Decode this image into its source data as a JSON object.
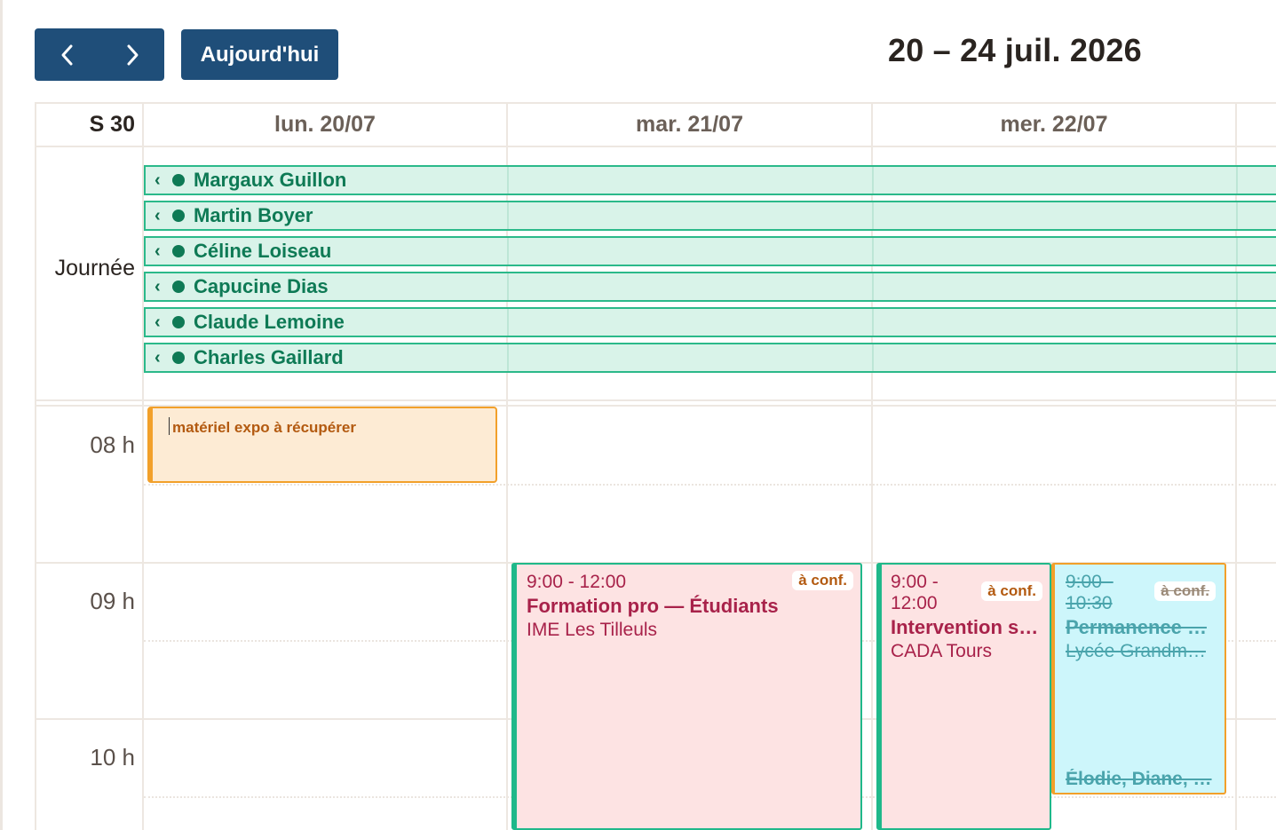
{
  "toolbar": {
    "prev_icon": "chevron-left-icon",
    "next_icon": "chevron-right-icon",
    "today_label": "Aujourd'hui",
    "title": "20 – 24 juil. 2026"
  },
  "header": {
    "week_label": "S 30",
    "days": [
      "lun. 20/07",
      "mar. 21/07",
      "mer. 22/07"
    ]
  },
  "allday": {
    "label": "Journée",
    "chevron": "‹",
    "items": [
      "Margaux Guillon",
      "Martin Boyer",
      "Céline Loiseau",
      "Capucine Dias",
      "Claude Lemoine",
      "Charles Gaillard"
    ]
  },
  "hours": [
    "08 h",
    "09 h",
    "10 h"
  ],
  "events": {
    "note": {
      "text": "matériel expo à récupérer"
    },
    "formation": {
      "time": "9:00 - 12:00",
      "badge": "à conf.",
      "title": "Formation pro — Étudiants",
      "location": "IME Les Tilleuls"
    },
    "intervention": {
      "time_start": "9:00 -",
      "time_end": "12:00",
      "badge": "à conf.",
      "title": "Intervention s…",
      "location": "CADA Tours"
    },
    "permanence": {
      "time_start": "9:00 -",
      "time_end": "10:30",
      "badge": "à conf.",
      "title": "Permanence …",
      "location": "Lycée Grandm…",
      "people": "Élodie, Diane, …"
    }
  },
  "colors": {
    "toolbar_button": "#1f4e79",
    "allday_bg": "#d9f3e9",
    "allday_border": "#2bb98a",
    "event_pink": "#fde3e3",
    "event_text": "#a8224a",
    "note_bg": "#fdebd4",
    "note_border": "#f2a02a",
    "cancelled_bg": "#cdf6fb"
  }
}
